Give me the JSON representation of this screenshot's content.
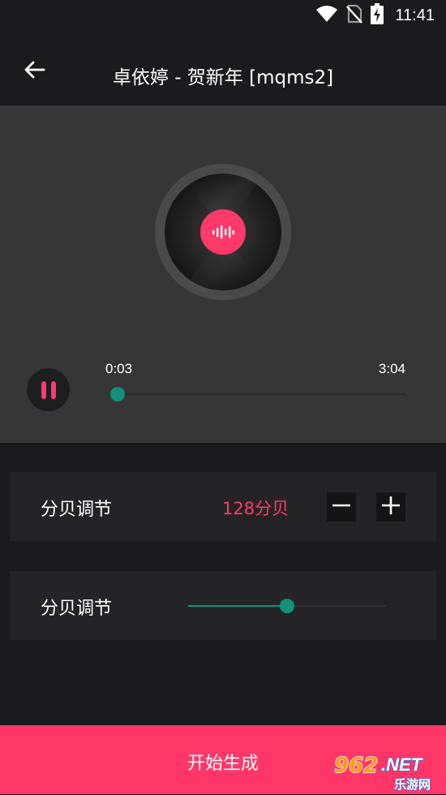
{
  "status_bar": {
    "time": "11:41",
    "icons": [
      "wifi-icon",
      "no-sim-icon",
      "battery-charging-icon"
    ]
  },
  "app_bar": {
    "back_icon": "arrow-left-icon",
    "title": "卓依婷 - 贺新年 [mqms2]"
  },
  "player": {
    "disc_icon": "audio-waveform-icon",
    "state_icon": "pause-icon",
    "current_time": "0:03",
    "total_time": "3:04",
    "progress": 0.016
  },
  "volume_stepper": {
    "label": "分贝调节",
    "value": "128分贝",
    "minus_icon": "minus-icon",
    "plus_icon": "plus-icon"
  },
  "volume_slider": {
    "label": "分贝调节",
    "level": 0.5
  },
  "generate_button": {
    "label": "开始生成"
  },
  "watermark": {
    "logo_text": "962.NET",
    "sub_text": "乐游网"
  },
  "colors": {
    "accent": "#ff3667",
    "teal": "#12907a",
    "background": "#1b1b1d",
    "player_bg": "#363636",
    "card_bg": "#242426"
  }
}
